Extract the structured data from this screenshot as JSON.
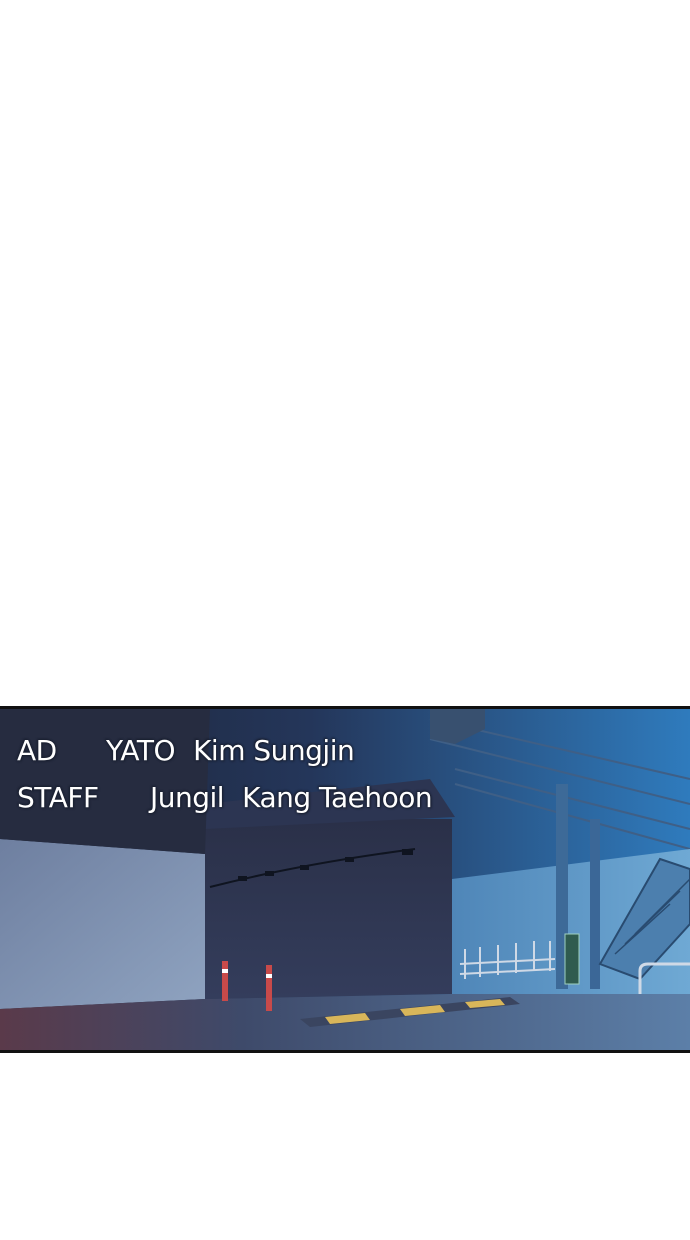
{
  "credits": {
    "ad": {
      "role": "AD",
      "names": [
        "YATO",
        "Kim Sungjin"
      ]
    },
    "staff": {
      "role": "STAFF",
      "names": [
        "Jungil",
        "Kang Taehoon"
      ]
    }
  },
  "colors": {
    "sky_blue": "#2f78b8",
    "dark_navy": "#1e2436",
    "wall_light": "#7f93b3",
    "ground": "#4a5a78",
    "accent_red": "#c84a4a",
    "speed_bump_yellow": "#d8b65a"
  }
}
